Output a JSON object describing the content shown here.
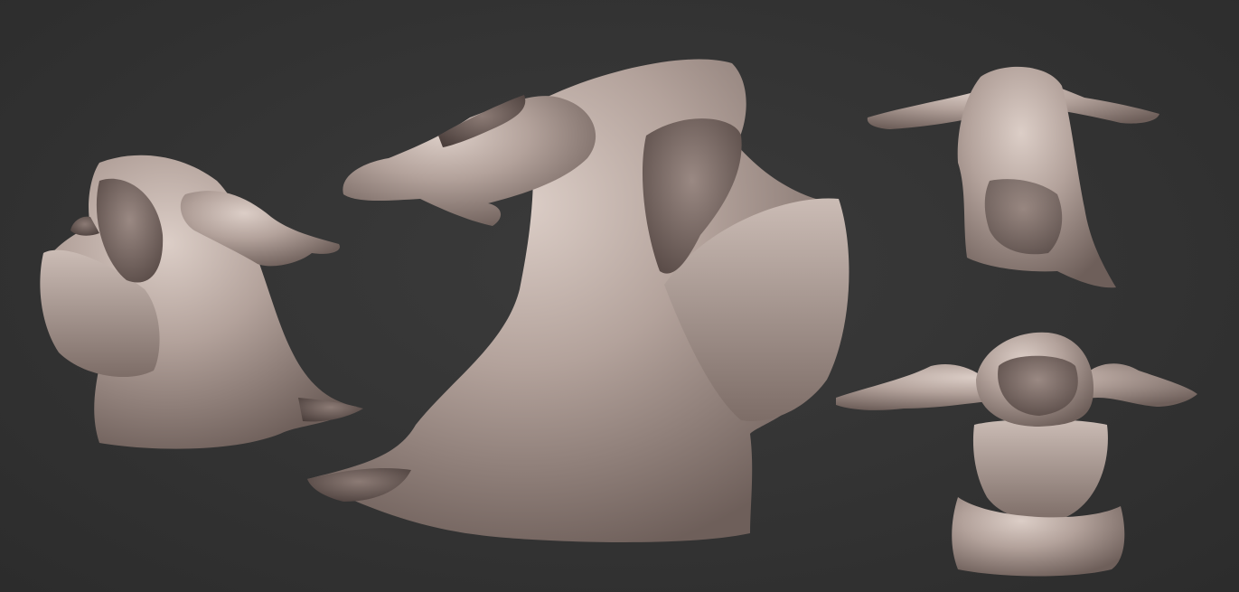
{
  "scene": {
    "background_color": "#333333",
    "material_color": "#a8968f",
    "material_highlight": "#d9cbc4",
    "material_shadow": "#5a4c48"
  },
  "views": [
    {
      "id": "left-three-quarter",
      "label": ""
    },
    {
      "id": "center-side",
      "label": ""
    },
    {
      "id": "top-right-back",
      "label": ""
    },
    {
      "id": "bottom-right-front",
      "label": ""
    }
  ]
}
